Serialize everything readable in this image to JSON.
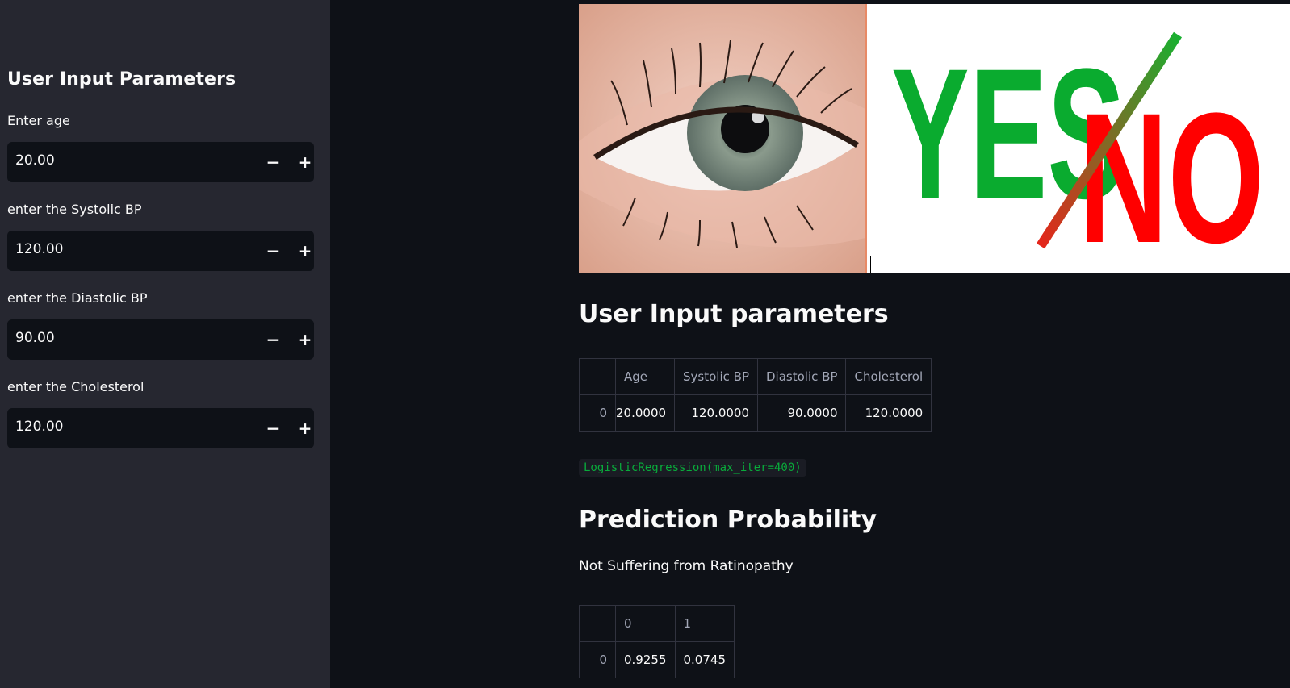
{
  "sidebar": {
    "title": "User Input Parameters",
    "fields": [
      {
        "label": "Enter age",
        "value": "20.00"
      },
      {
        "label": "enter the Systolic BP",
        "value": "120.00"
      },
      {
        "label": "enter the Diastolic BP",
        "value": "90.00"
      },
      {
        "label": "enter the Cholesterol",
        "value": "120.00"
      }
    ],
    "minus_glyph": "−",
    "plus_glyph": "+"
  },
  "hero": {
    "yes_text": "YES",
    "no_text": "NO",
    "yes_color": "#0aab2f",
    "no_color": "#ff0000"
  },
  "main": {
    "input_heading": "User Input parameters",
    "input_table": {
      "columns": [
        "",
        "Age",
        "Systolic BP",
        "Diastolic BP",
        "Cholesterol"
      ],
      "rows": [
        [
          "0",
          "20.0000",
          "120.0000",
          "90.0000",
          "120.0000"
        ]
      ]
    },
    "model_code": "LogisticRegression(max_iter=400)",
    "prediction_heading": "Prediction Probability",
    "prediction_text": "Not Suffering from Ratinopathy",
    "prob_table": {
      "columns": [
        "",
        "0",
        "1"
      ],
      "rows": [
        [
          "0",
          "0.9255",
          "0.0745"
        ]
      ]
    }
  },
  "colors": {
    "app_bg": "#0e1117",
    "sidebar_bg": "#262730",
    "code_green": "#09ab3b"
  }
}
